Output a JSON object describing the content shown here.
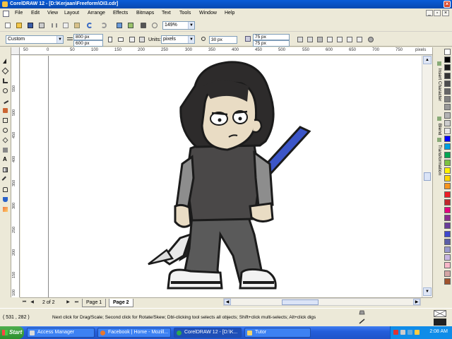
{
  "window": {
    "title": "CorelDRAW 12 - [D:\\Kerjaan\\Freeform\\OI3.cdr]",
    "close_label": "×"
  },
  "menu": {
    "items": [
      "File",
      "Edit",
      "View",
      "Layout",
      "Arrange",
      "Effects",
      "Bitmaps",
      "Text",
      "Tools",
      "Window",
      "Help"
    ],
    "controls": [
      "_",
      "▫",
      "×"
    ]
  },
  "standard_toolbar": {
    "zoom_level": "149%"
  },
  "property_bar": {
    "paper_type": "Custom",
    "width": "800 px",
    "height": "600 px",
    "units_label": "Units:",
    "units_value": "pixels",
    "nudge": "30 px",
    "dup_x": "75 px",
    "dup_y": "75 px"
  },
  "rulers": {
    "horizontal_ticks": [
      "50",
      "0",
      "50",
      "100",
      "150",
      "200",
      "250",
      "300",
      "350",
      "400",
      "450",
      "500",
      "550",
      "600",
      "650",
      "700",
      "750",
      "800"
    ],
    "horizontal_unit": "pixels",
    "vertical_ticks": [
      "550",
      "500",
      "450",
      "400",
      "350",
      "300",
      "250",
      "200",
      "150",
      "100",
      "50"
    ]
  },
  "dockers": [
    "Insert Character",
    "Blend",
    "Transformation"
  ],
  "palette": {
    "colors": [
      "#ffffff",
      "#000000",
      "#1a1a1a",
      "#333333",
      "#4d4d4d",
      "#666666",
      "#808080",
      "#999999",
      "#b3b3b3",
      "#cccccc",
      "#e6e6e6",
      "#0000ff",
      "#00a0e0",
      "#00a651",
      "#7cc242",
      "#fff200",
      "#ffd600",
      "#f7941d",
      "#ed1c24",
      "#c1272d",
      "#e5007e",
      "#8b2c8e",
      "#6a3d9a",
      "#3f48cc",
      "#5b5ea6",
      "#9999cc",
      "#c8b6e2",
      "#f7b7c8",
      "#d4a5a5",
      "#a0522d"
    ]
  },
  "pages": {
    "indicator": "2 of 2",
    "tabs": [
      "Page 1",
      "Page 2"
    ],
    "active": "Page 2"
  },
  "status": {
    "coords": "( 531 , 282 )",
    "message": "Next click for Drag/Scale; Second click for Rotate/Skew; Dbl-clicking tool selects all objects; Shift+click multi-selects; Alt+click digs"
  },
  "taskbar": {
    "start_label": "Start",
    "buttons": [
      {
        "label": "Access Manager",
        "icon_color": "#d9d9d9"
      },
      {
        "label": "Facebook | Home - Mozill...",
        "icon_color": "#e8762c"
      },
      {
        "label": "CorelDRAW 12 - [D:\\K...",
        "icon_color": "#2fa84f"
      },
      {
        "label": "Tutor",
        "icon_color": "#f4d46b"
      }
    ],
    "clock": "2:08 AM"
  }
}
